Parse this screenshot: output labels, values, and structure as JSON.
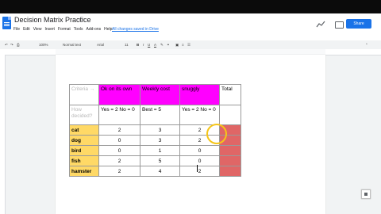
{
  "document": {
    "title": "Decision Matrix Practice",
    "star_icon": "star-icon",
    "menu": [
      "File",
      "Edit",
      "View",
      "Insert",
      "Format",
      "Tools",
      "Add-ons",
      "Help"
    ],
    "last_edit": "All changes saved in Drive",
    "share_label": "Share"
  },
  "toolbar": {
    "zoom": "100%",
    "style": "Normal text",
    "font": "Arial",
    "size": "11"
  },
  "table": {
    "header": {
      "criteria": "Criteria →",
      "c1": "Ok on its own",
      "c2": "Weekly cost",
      "c3": "snuggly",
      "total": "Total"
    },
    "descriptor": {
      "label": "How decided?",
      "c1": "Yes = 2\nNo = 0",
      "c2": "Best = 5",
      "c3": "Yes = 2\nNo = 0"
    },
    "rows": [
      {
        "animal": "cat",
        "v1": "2",
        "v2": "3",
        "v3": "2"
      },
      {
        "animal": "dog",
        "v1": "0",
        "v2": "3",
        "v3": "2"
      },
      {
        "animal": "bird",
        "v1": "0",
        "v2": "1",
        "v3": "0"
      },
      {
        "animal": "fish",
        "v1": "2",
        "v2": "5",
        "v3": "0"
      },
      {
        "animal": "hamster",
        "v1": "2",
        "v2": "4",
        "v3": "2"
      }
    ]
  },
  "colors": {
    "header_magenta": "#ff00ff",
    "animal_yellow": "#ffd966",
    "total_red": "#e06666",
    "share_blue": "#1a73e8",
    "highlight_circle": "#f5c518"
  }
}
